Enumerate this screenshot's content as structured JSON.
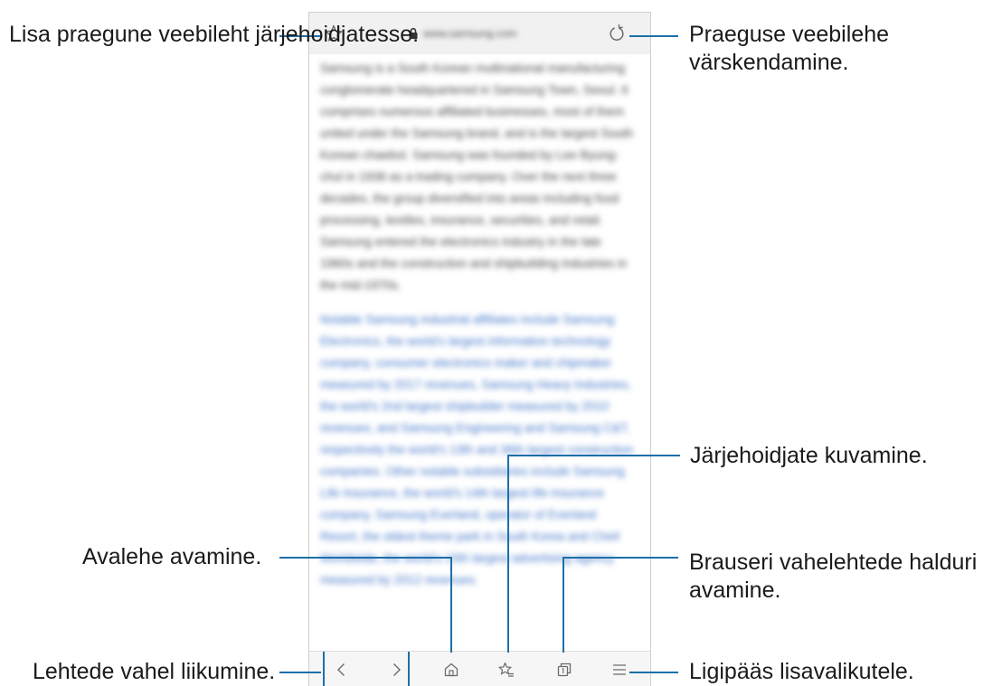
{
  "browser": {
    "url_text": "www.samsung.com",
    "content": {
      "paragraph_1": "Samsung is a South Korean multinational manufacturing conglomerate headquartered in Samsung Town, Seoul. It comprises numerous affiliated businesses, most of them united under the Samsung brand, and is the largest South Korean chaebol. Samsung was founded by Lee Byung-chul in 1938 as a trading company. Over the next three decades, the group diversified into areas including food processing, textiles, insurance, securities, and retail. Samsung entered the electronics industry in the late 1960s and the construction and shipbuilding industries in the mid-1970s.",
      "paragraph_2": "Notable Samsung industrial affiliates include Samsung Electronics, the world's largest information technology company, consumer electronics maker and chipmaker measured by 2017 revenues, Samsung Heavy Industries, the world's 2nd largest shipbuilder measured by 2010 revenues, and Samsung Engineering and Samsung C&T, respectively the world's 13th and 36th largest construction companies. Other notable subsidiaries include Samsung Life Insurance, the world's 14th largest life insurance company, Samsung Everland, operator of Everland Resort, the oldest theme park in South Korea and Cheil Worldwide, the world's 15th largest advertising agency measured by 2012 revenues."
    }
  },
  "annotations": {
    "bookmark_page": "Lisa praegune veebileht järjehoidjatesse.",
    "refresh_page": "Praeguse veebilehe värskendamine.",
    "view_bookmarks": "Järjehoidjate kuvamine.",
    "open_homepage": "Avalehe avamine.",
    "tab_manager": "Brauseri vahelehtede halduri avamine.",
    "navigate_pages": "Lehtede vahel liikumine.",
    "more_options": "Ligipääs lisavalikutele."
  },
  "colors": {
    "leader_line": "#1e6fa8",
    "icon": "#6b6b6b",
    "link_text": "#3f74c9"
  },
  "icons": {
    "add_bookmark": "star-outline-icon",
    "lock": "lock-icon",
    "reload": "reload-icon",
    "back": "chevron-left-icon",
    "forward": "chevron-right-icon",
    "home": "home-icon",
    "bookmarks": "star-list-icon",
    "tabs": "tabs-icon",
    "menu": "hamburger-menu-icon"
  }
}
